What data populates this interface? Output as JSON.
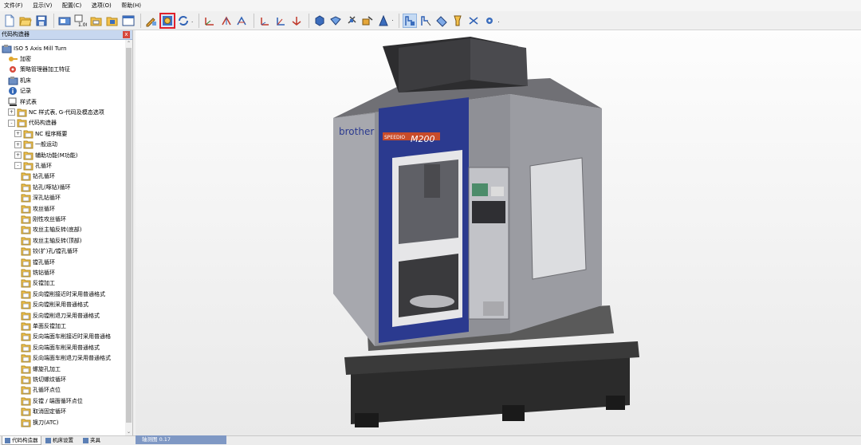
{
  "menu": [
    "文件(F)",
    "显示(V)",
    "配置(C)",
    "选项(O)",
    "帮助(H)"
  ],
  "panel": {
    "title": "代码构造器",
    "close": "x"
  },
  "tree": [
    {
      "label": "ISO 5 Axis Mill Turn",
      "icon": "machine-icon"
    },
    {
      "label": "加密",
      "icon": "key-icon"
    },
    {
      "label": "策略管理器加工特征",
      "icon": "strategy-icon"
    },
    {
      "label": "机床",
      "icon": "machine-icon"
    },
    {
      "label": "记录",
      "icon": "info-icon"
    },
    {
      "label": "样式表",
      "icon": "style-table-icon"
    },
    {
      "label": "NC 样式表, G-代码及模态选项",
      "icon": "folder-icon"
    },
    {
      "label": "代码构造器",
      "icon": "folder-icon"
    },
    {
      "label": "NC 程序概要",
      "icon": "folder-icon"
    },
    {
      "label": "一般运动",
      "icon": "folder-icon"
    },
    {
      "label": "辅助功能(M功能)",
      "icon": "folder-icon"
    },
    {
      "label": "孔循环",
      "icon": "folder-icon"
    },
    {
      "label": "钻孔循环",
      "icon": "folder-icon"
    },
    {
      "label": "钻孔(啄钻)循环",
      "icon": "folder-icon"
    },
    {
      "label": "深孔钻循环",
      "icon": "folder-icon"
    },
    {
      "label": "攻丝循环",
      "icon": "folder-icon"
    },
    {
      "label": "刚性攻丝循环",
      "icon": "folder-icon"
    },
    {
      "label": "攻丝主轴反转(底部)",
      "icon": "folder-icon"
    },
    {
      "label": "攻丝主轴反转(顶部)",
      "icon": "folder-icon"
    },
    {
      "label": "铰(扩)孔/镗孔循环",
      "icon": "folder-icon"
    },
    {
      "label": "镗孔循环",
      "icon": "folder-icon"
    },
    {
      "label": "铣钻循环",
      "icon": "folder-icon"
    },
    {
      "label": "反镗加工",
      "icon": "folder-icon"
    },
    {
      "label": "反向镗削接近时采用普通格式",
      "icon": "folder-icon"
    },
    {
      "label": "反向镗削采用普通格式",
      "icon": "folder-icon"
    },
    {
      "label": "反向镗削退刀采用普通格式",
      "icon": "folder-icon"
    },
    {
      "label": "单面反镗加工",
      "icon": "folder-icon"
    },
    {
      "label": "反向端面车削接近时采用普通格",
      "icon": "folder-icon"
    },
    {
      "label": "反向端面车削采用普通格式",
      "icon": "folder-icon"
    },
    {
      "label": "反向端面车削退刀采用普通格式",
      "icon": "folder-icon"
    },
    {
      "label": "螺旋孔加工",
      "icon": "folder-icon"
    },
    {
      "label": "铣切螺纹循环",
      "icon": "folder-icon"
    },
    {
      "label": "孔循环点位",
      "icon": "folder-icon"
    },
    {
      "label": "反镗 / 端面循环点位",
      "icon": "folder-icon"
    },
    {
      "label": "取消固定循环",
      "icon": "folder-icon"
    },
    {
      "label": "换刀(ATC)",
      "icon": "folder-icon"
    }
  ],
  "bottom_tabs": [
    "代码构造器",
    "机床设置",
    "夹具"
  ],
  "viewport_tab": "轴测图 0.17",
  "machine": {
    "brand": "brother",
    "model_series": "SPEEDIO",
    "model": "M200"
  },
  "colors": {
    "accent_blue": "#2b3a8f",
    "selection_red": "#e0212a",
    "panel_header": "#c7d7ef"
  },
  "scroll": {
    "up": "⌃",
    "down": "⌄"
  }
}
